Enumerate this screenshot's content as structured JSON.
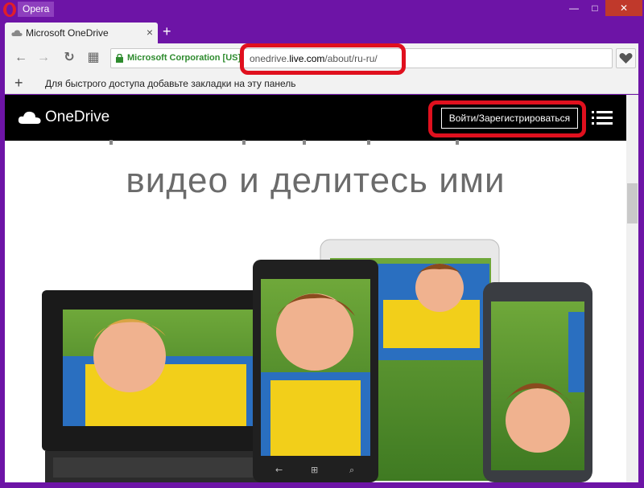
{
  "window": {
    "app_label": "Opera",
    "minimize": "—",
    "maximize": "□",
    "close": "✕"
  },
  "tab": {
    "title": "Microsoft OneDrive",
    "close": "×",
    "new_tab": "+"
  },
  "toolbar": {
    "back": "←",
    "forward": "→",
    "reload": "↻",
    "speed_dial": "▦",
    "cert_label": "Microsoft Corporation [US]",
    "url_prefix": "onedrive.",
    "url_domain": "live.com",
    "url_path": "/about/ru-ru/"
  },
  "bookmarks_bar": {
    "add": "+",
    "hint": "Для быстрого доступа добавьте закладки на эту панель"
  },
  "page": {
    "brand": "OneDrive",
    "signin_label": "Войти/Зарегистрироваться",
    "hero_text": "видео и делитесь ими"
  },
  "icons": [
    "opera-logo-icon",
    "onedrive-favicon-icon",
    "lock-icon",
    "heart-icon",
    "cloud-icon",
    "menu-icon"
  ],
  "colors": {
    "window_accent": "#6d14a6",
    "highlight": "#e0101e",
    "cert_green": "#2e8b2e"
  }
}
